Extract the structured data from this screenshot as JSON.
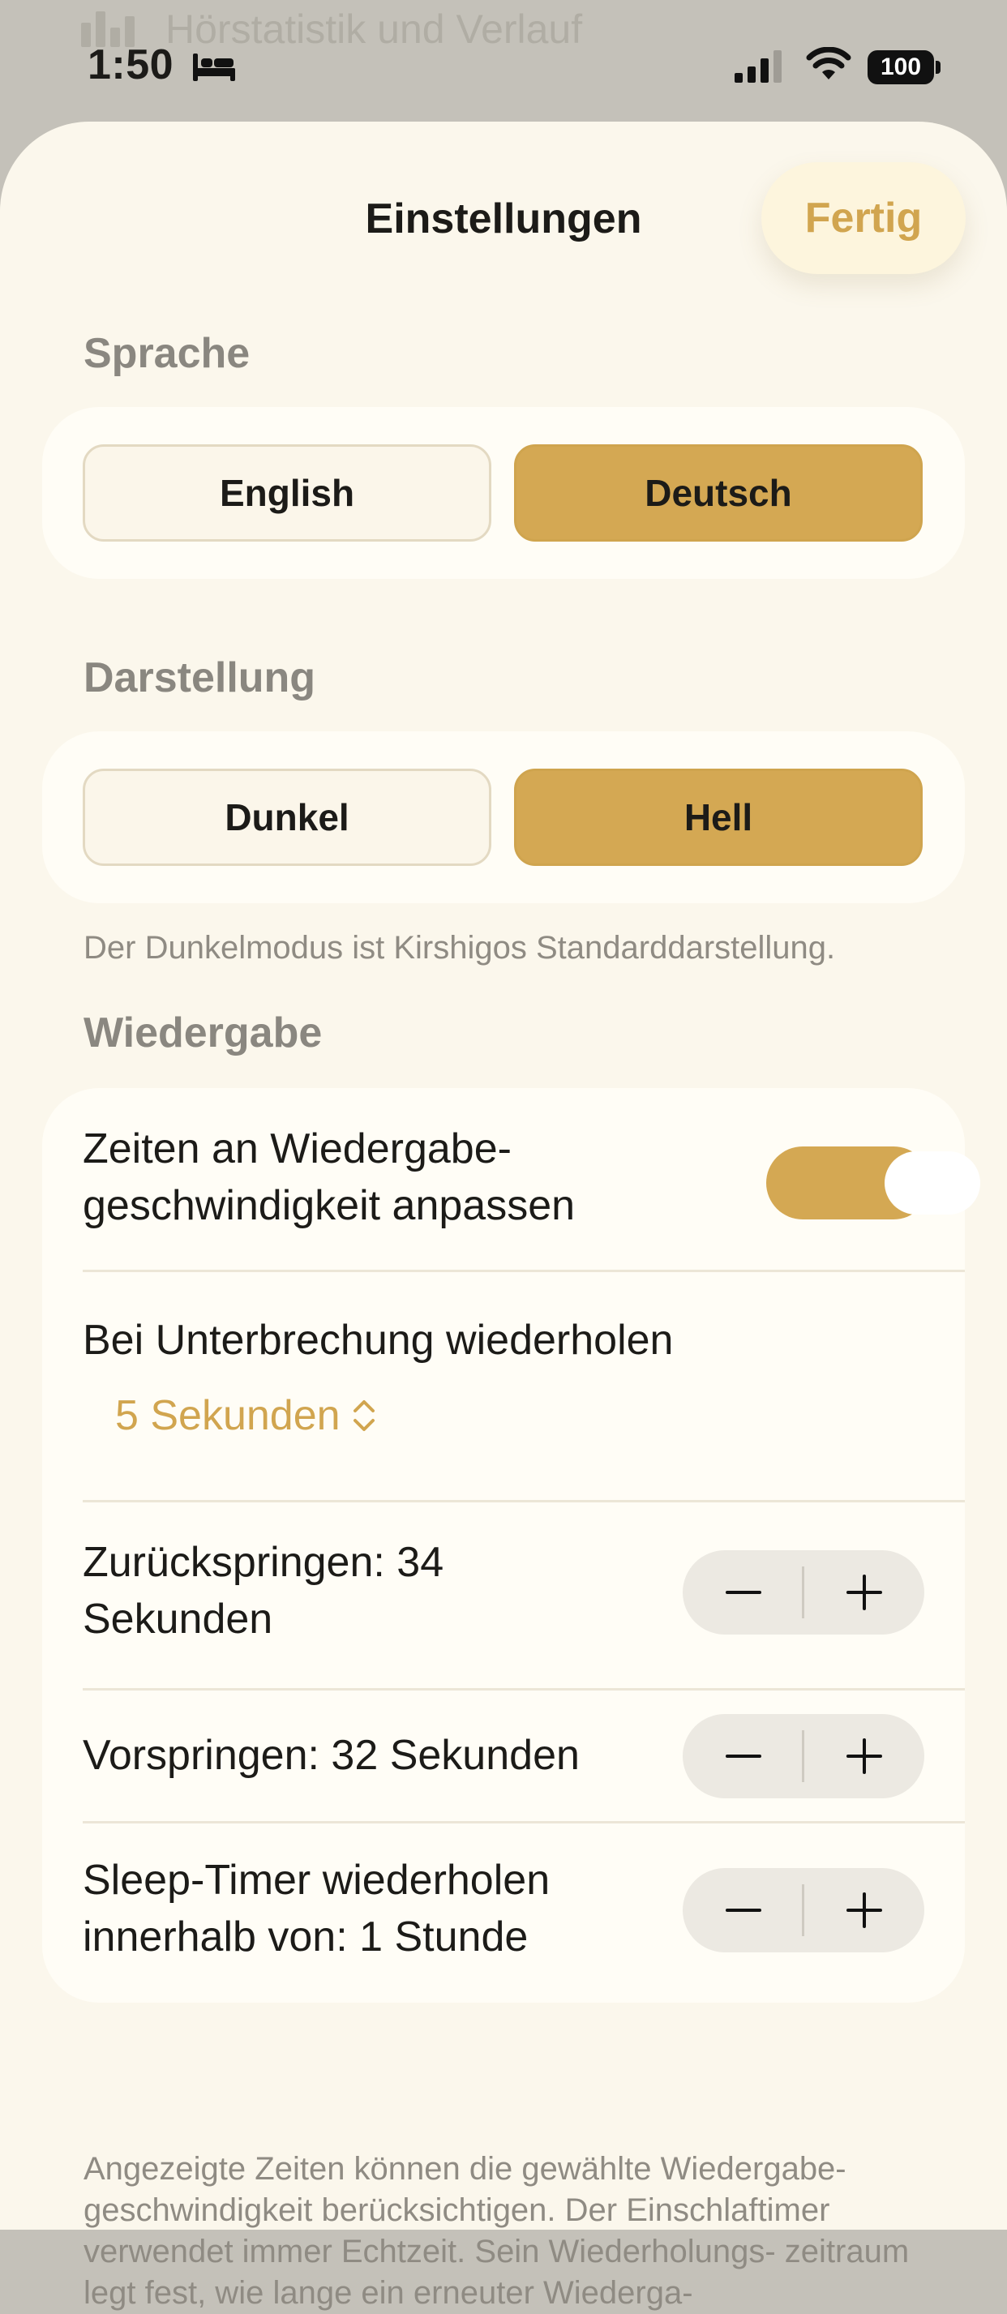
{
  "background": {
    "row_text": "Hörstatistik und Verlauf"
  },
  "status_bar": {
    "time": "1:50",
    "battery": "100"
  },
  "sheet": {
    "title": "Einstellungen",
    "done": "Fertig"
  },
  "language": {
    "label": "Sprache",
    "options": [
      "English",
      "Deutsch"
    ],
    "selected": "Deutsch"
  },
  "appearance": {
    "label": "Darstellung",
    "options": [
      "Dunkel",
      "Hell"
    ],
    "selected": "Hell",
    "note": "Der Dunkelmodus ist Kirshigos Standarddarstellung."
  },
  "playback": {
    "label": "Wiedergabe",
    "adjust_times": {
      "line1": "Zeiten an Wiedergabe-",
      "line2": "geschwindigkeit anpassen",
      "enabled": true
    },
    "repeat_on_interrupt": {
      "label": "Bei Unterbrechung wiederholen",
      "value": "5 Sekunden"
    },
    "skip_back": {
      "line1": "Zurückspringen: 34",
      "line2": "Sekunden"
    },
    "skip_forward": {
      "line1": "Vorspringen: 32 Sekunden"
    },
    "sleep_timer": {
      "line1": "Sleep-Timer wiederholen",
      "line2": "innerhalb von: 1 Stunde"
    },
    "footnote": "Angezeigte Zeiten können die gewählte Wiedergabe- geschwindigkeit berücksichtigen. Der Einschlaftimer verwendet immer Echtzeit. Sein Wiederholungs- zeitraum legt fest, wie lange ein erneuter Wiederga-"
  },
  "colors": {
    "accent": "#D4A853",
    "sheet_bg": "#FBF7EC",
    "card_bg": "#FFFDF6",
    "secondary_text": "#8A8780"
  }
}
